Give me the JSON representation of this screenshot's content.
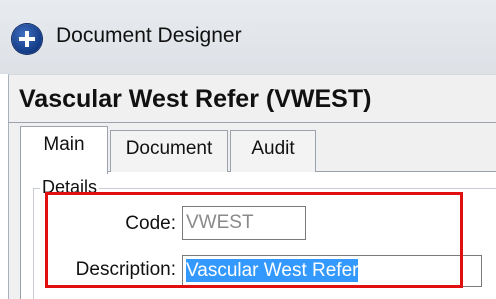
{
  "window": {
    "title": "Document Designer",
    "icon": "plus-circle-icon"
  },
  "header": {
    "title": "Vascular West Refer (VWEST)"
  },
  "tabs": [
    {
      "label": "Main",
      "active": true
    },
    {
      "label": "Document",
      "active": false
    },
    {
      "label": "Audit",
      "active": false
    }
  ],
  "details": {
    "legend": "Details",
    "code": {
      "label": "Code:",
      "value": "VWEST"
    },
    "description": {
      "label": "Description:",
      "value": "Vascular West Refer"
    }
  },
  "colors": {
    "highlight": "#e01010",
    "selection": "#3399ff"
  }
}
